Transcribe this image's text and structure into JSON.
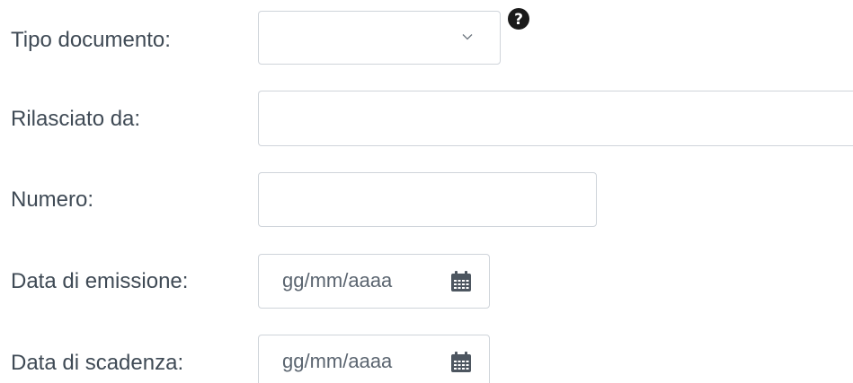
{
  "fields": {
    "tipo_documento": {
      "label": "Tipo documento:",
      "selected_value": "",
      "icon": "chevron-down-icon",
      "help_icon": "question-circle-icon"
    },
    "rilasciato_da": {
      "label": "Rilasciato da:",
      "value": ""
    },
    "numero": {
      "label": "Numero:",
      "value": ""
    },
    "data_emissione": {
      "label": "Data di emissione:",
      "placeholder": "gg/mm/aaaa",
      "icon": "calendar-icon"
    },
    "data_scadenza": {
      "label": "Data di scadenza:",
      "placeholder": "gg/mm/aaaa",
      "icon": "calendar-icon"
    }
  },
  "colors": {
    "label_text": "#3f4a55",
    "border": "#cfd4da",
    "help_icon": "#1a1a1a",
    "calendar_icon": "#4d5660"
  }
}
